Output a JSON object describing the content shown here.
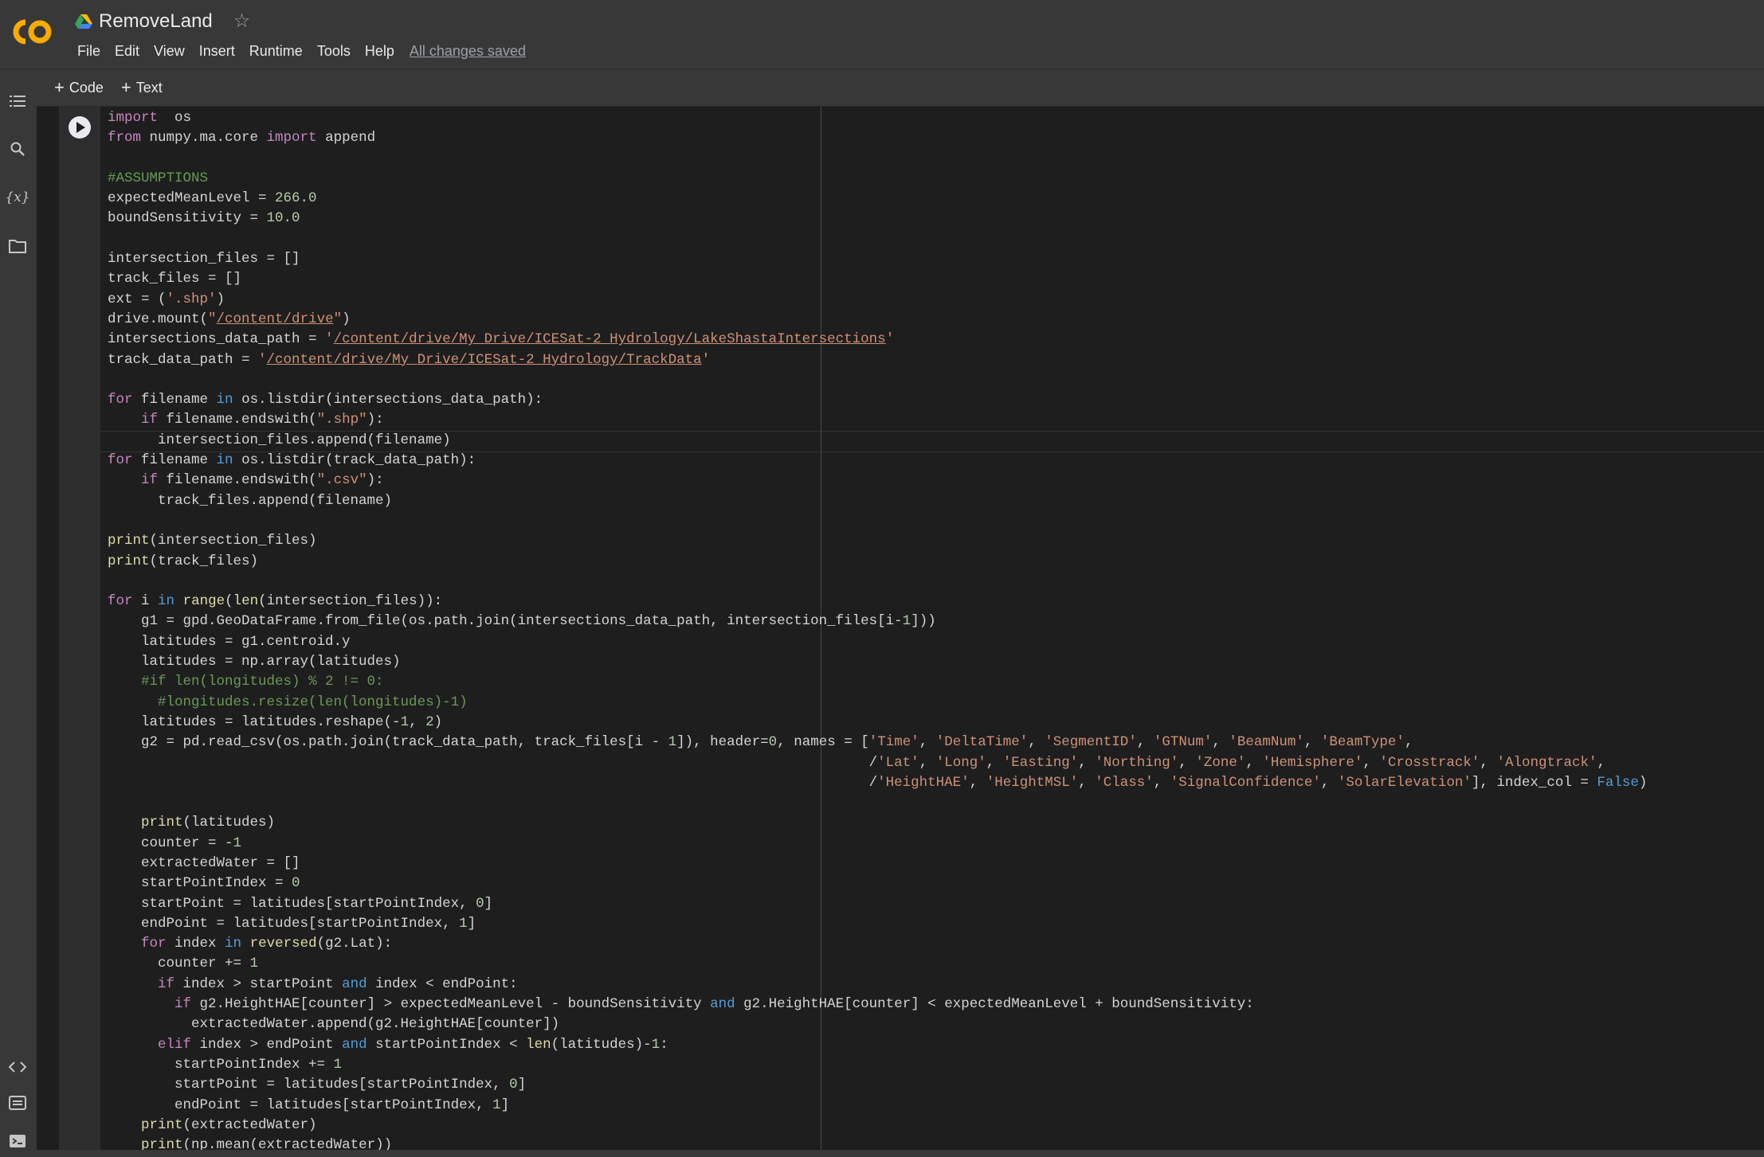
{
  "header": {
    "title": "RemoveLand",
    "saved_status": "All changes saved",
    "menu": [
      "File",
      "Edit",
      "View",
      "Insert",
      "Runtime",
      "Tools",
      "Help"
    ]
  },
  "toolbar": {
    "code_label": "Code",
    "text_label": "Text"
  },
  "sidebar": {
    "icons": [
      "table-of-contents-icon",
      "search-icon",
      "variables-icon",
      "files-icon",
      "code-snippets-icon",
      "command-palette-icon",
      "terminal-icon"
    ]
  },
  "colors": {
    "logo_orange": "#f9ab00",
    "header_bg": "#383838",
    "editor_bg": "#1e1e1e"
  },
  "code_lines": [
    [
      [
        "kw",
        "import"
      ],
      [
        "",
        "  os"
      ]
    ],
    [
      [
        "kw",
        "from"
      ],
      [
        "",
        " numpy.ma.core "
      ],
      [
        "kw",
        "import"
      ],
      [
        "",
        " append"
      ]
    ],
    [],
    [
      [
        "cm",
        "#ASSUMPTIONS"
      ]
    ],
    [
      [
        "",
        "expectedMeanLevel = "
      ],
      [
        "num",
        "266.0"
      ]
    ],
    [
      [
        "",
        "boundSensitivity = "
      ],
      [
        "num",
        "10.0"
      ]
    ],
    [],
    [
      [
        "",
        "intersection_files = []"
      ]
    ],
    [
      [
        "",
        "track_files = []"
      ]
    ],
    [
      [
        "",
        "ext = ("
      ],
      [
        "str",
        "'.shp'"
      ],
      [
        "",
        ")"
      ]
    ],
    [
      [
        "",
        "drive.mount("
      ],
      [
        "str",
        "\""
      ],
      [
        "str ul",
        "/content/drive"
      ],
      [
        "str",
        "\""
      ],
      [
        "",
        ")"
      ]
    ],
    [
      [
        "",
        "intersections_data_path = "
      ],
      [
        "str",
        "'"
      ],
      [
        "str ul",
        "/content/drive/My Drive/ICESat-2_Hydrology/LakeShastaIntersections"
      ],
      [
        "str",
        "'"
      ]
    ],
    [
      [
        "",
        "track_data_path = "
      ],
      [
        "str",
        "'"
      ],
      [
        "str ul",
        "/content/drive/My Drive/ICESat-2_Hydrology/TrackData"
      ],
      [
        "str",
        "'"
      ]
    ],
    [],
    [
      [
        "kw",
        "for"
      ],
      [
        "",
        " filename "
      ],
      [
        "kb",
        "in"
      ],
      [
        "",
        " os.listdir(intersections_data_path):"
      ]
    ],
    [
      [
        "",
        "    "
      ],
      [
        "kw",
        "if"
      ],
      [
        "",
        " filename.endswith("
      ],
      [
        "str",
        "\".shp\""
      ],
      [
        "",
        "):"
      ]
    ],
    [
      [
        "",
        "      intersection_files.append(filename)"
      ]
    ],
    [
      [
        "kw",
        "for"
      ],
      [
        "",
        " filename "
      ],
      [
        "kb",
        "in"
      ],
      [
        "",
        " os.listdir(track_data_path):"
      ]
    ],
    [
      [
        "",
        "    "
      ],
      [
        "kw",
        "if"
      ],
      [
        "",
        " filename.endswith("
      ],
      [
        "str",
        "\".csv\""
      ],
      [
        "",
        "):"
      ]
    ],
    [
      [
        "",
        "      track_files.append(filename)"
      ]
    ],
    [],
    [
      [
        "fn",
        "print"
      ],
      [
        "",
        "(intersection_files)"
      ]
    ],
    [
      [
        "fn",
        "print"
      ],
      [
        "",
        "(track_files)"
      ]
    ],
    [],
    [
      [
        "kw",
        "for"
      ],
      [
        "",
        " i "
      ],
      [
        "kb",
        "in"
      ],
      [
        " ",
        " "
      ],
      [
        "fn",
        "range"
      ],
      [
        "",
        "("
      ],
      [
        "fn",
        "len"
      ],
      [
        "",
        "(intersection_files)):"
      ]
    ],
    [
      [
        "",
        "    g1 = gpd.GeoDataFrame.from_file(os.path.join(intersections_data_path, intersection_files[i-"
      ],
      [
        "num",
        "1"
      ],
      [
        "",
        "]))"
      ]
    ],
    [
      [
        "",
        "    latitudes = g1.centroid.y"
      ]
    ],
    [
      [
        "",
        "    latitudes = np.array(latitudes)"
      ]
    ],
    [
      [
        "cm",
        "    #if len(longitudes) % 2 != 0:"
      ]
    ],
    [
      [
        "cm",
        "      #longitudes.resize(len(longitudes)-1)"
      ]
    ],
    [
      [
        "",
        "    latitudes = latitudes.reshape(-"
      ],
      [
        "num",
        "1"
      ],
      [
        "",
        ", "
      ],
      [
        "num",
        "2"
      ],
      [
        "",
        ")"
      ]
    ],
    [
      [
        "",
        "    g2 = pd.read_csv(os.path.join(track_data_path, track_files[i - "
      ],
      [
        "num",
        "1"
      ],
      [
        "",
        "]), header="
      ],
      [
        "num",
        "0"
      ],
      [
        "",
        ", names = ["
      ],
      [
        "str",
        "'Time'"
      ],
      [
        "",
        ", "
      ],
      [
        "str",
        "'DeltaTime'"
      ],
      [
        "",
        ", "
      ],
      [
        "str",
        "'SegmentID'"
      ],
      [
        "",
        ", "
      ],
      [
        "str",
        "'GTNum'"
      ],
      [
        "",
        ", "
      ],
      [
        "str",
        "'BeamNum'"
      ],
      [
        "",
        ", "
      ],
      [
        "str",
        "'BeamType'"
      ],
      [
        "",
        ","
      ]
    ],
    [
      [
        "",
        "                                                                                           /"
      ],
      [
        "str",
        "'Lat'"
      ],
      [
        "",
        ", "
      ],
      [
        "str",
        "'Long'"
      ],
      [
        "",
        ", "
      ],
      [
        "str",
        "'Easting'"
      ],
      [
        "",
        ", "
      ],
      [
        "str",
        "'Northing'"
      ],
      [
        "",
        ", "
      ],
      [
        "str",
        "'Zone'"
      ],
      [
        "",
        ", "
      ],
      [
        "str",
        "'Hemisphere'"
      ],
      [
        "",
        ", "
      ],
      [
        "str",
        "'Crosstrack'"
      ],
      [
        "",
        ", "
      ],
      [
        "str",
        "'Alongtrack'"
      ],
      [
        "",
        ","
      ]
    ],
    [
      [
        "",
        "                                                                                           /"
      ],
      [
        "str",
        "'HeightHAE'"
      ],
      [
        "",
        ", "
      ],
      [
        "str",
        "'HeightMSL'"
      ],
      [
        "",
        ", "
      ],
      [
        "str",
        "'Class'"
      ],
      [
        "",
        ", "
      ],
      [
        "str",
        "'SignalConfidence'"
      ],
      [
        "",
        ", "
      ],
      [
        "str",
        "'SolarElevation'"
      ],
      [
        "",
        "], index_col = "
      ],
      [
        "kb",
        "False"
      ],
      [
        "",
        ")"
      ]
    ],
    [],
    [
      [
        "",
        "    "
      ],
      [
        "fn",
        "print"
      ],
      [
        "",
        "(latitudes)"
      ]
    ],
    [
      [
        "",
        "    counter = -"
      ],
      [
        "num",
        "1"
      ]
    ],
    [
      [
        "",
        "    extractedWater = []"
      ]
    ],
    [
      [
        "",
        "    startPointIndex = "
      ],
      [
        "num",
        "0"
      ]
    ],
    [
      [
        "",
        "    startPoint = latitudes[startPointIndex, "
      ],
      [
        "num",
        "0"
      ],
      [
        "",
        "]"
      ]
    ],
    [
      [
        "",
        "    endPoint = latitudes[startPointIndex, "
      ],
      [
        "num",
        "1"
      ],
      [
        "",
        "]"
      ]
    ],
    [
      [
        "",
        "    "
      ],
      [
        "kw",
        "for"
      ],
      [
        "",
        " index "
      ],
      [
        "kb",
        "in"
      ],
      [
        " ",
        " "
      ],
      [
        "fn",
        "reversed"
      ],
      [
        "",
        "(g2.Lat):"
      ]
    ],
    [
      [
        "",
        "      counter += "
      ],
      [
        "num",
        "1"
      ]
    ],
    [
      [
        "",
        "      "
      ],
      [
        "kw",
        "if"
      ],
      [
        "",
        " index > startPoint "
      ],
      [
        "kb",
        "and"
      ],
      [
        "",
        " index < endPoint:"
      ]
    ],
    [
      [
        "",
        "        "
      ],
      [
        "kw",
        "if"
      ],
      [
        "",
        " g2.HeightHAE[counter] > expectedMeanLevel - boundSensitivity "
      ],
      [
        "kb",
        "and"
      ],
      [
        "",
        " g2.HeightHAE[counter] < expectedMeanLevel + boundSensitivity:"
      ]
    ],
    [
      [
        "",
        "          extractedWater.append(g2.HeightHAE[counter])"
      ]
    ],
    [
      [
        "",
        "      "
      ],
      [
        "kw",
        "elif"
      ],
      [
        "",
        " index > endPoint "
      ],
      [
        "kb",
        "and"
      ],
      [
        "",
        " startPointIndex < "
      ],
      [
        "fn",
        "len"
      ],
      [
        "",
        "(latitudes)-"
      ],
      [
        "num",
        "1"
      ],
      [
        "",
        ":"
      ]
    ],
    [
      [
        "",
        "        startPointIndex += "
      ],
      [
        "num",
        "1"
      ]
    ],
    [
      [
        "",
        "        startPoint = latitudes[startPointIndex, "
      ],
      [
        "num",
        "0"
      ],
      [
        "",
        "]"
      ]
    ],
    [
      [
        "",
        "        endPoint = latitudes[startPointIndex, "
      ],
      [
        "num",
        "1"
      ],
      [
        "",
        "]"
      ]
    ],
    [
      [
        "",
        "    "
      ],
      [
        "fn",
        "print"
      ],
      [
        "",
        "(extractedWater)"
      ]
    ],
    [
      [
        "",
        "    "
      ],
      [
        "fn",
        "print"
      ],
      [
        "",
        "(np.mean(extractedWater))"
      ]
    ]
  ]
}
